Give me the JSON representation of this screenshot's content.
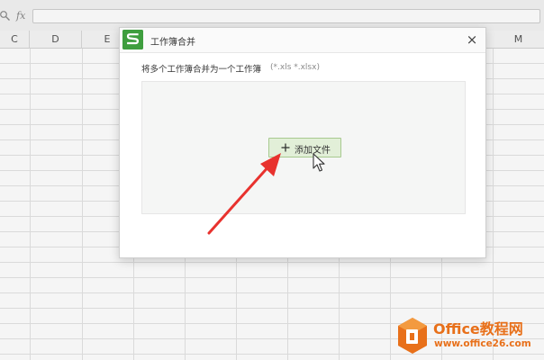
{
  "formula_bar": {
    "fx_label": "fx",
    "value": ""
  },
  "sheet": {
    "columns": [
      "C",
      "D",
      "E",
      "",
      "",
      "",
      "",
      "",
      "",
      "M"
    ]
  },
  "dialog": {
    "logo_letter": "S",
    "title": "工作簿合并",
    "close_label": "×",
    "instruction": "将多个工作簿合并为一个工作簿",
    "file_types": "(*.xls *.xlsx)",
    "add_file_label": "添加文件"
  },
  "watermark": {
    "brand": "Office教程网",
    "url": "www.office26.com"
  },
  "colors": {
    "accent_green": "#3e9e3e",
    "button_fill": "#e2efd8",
    "arrow_red": "#e8322e",
    "watermark_orange": "#e8701a"
  }
}
